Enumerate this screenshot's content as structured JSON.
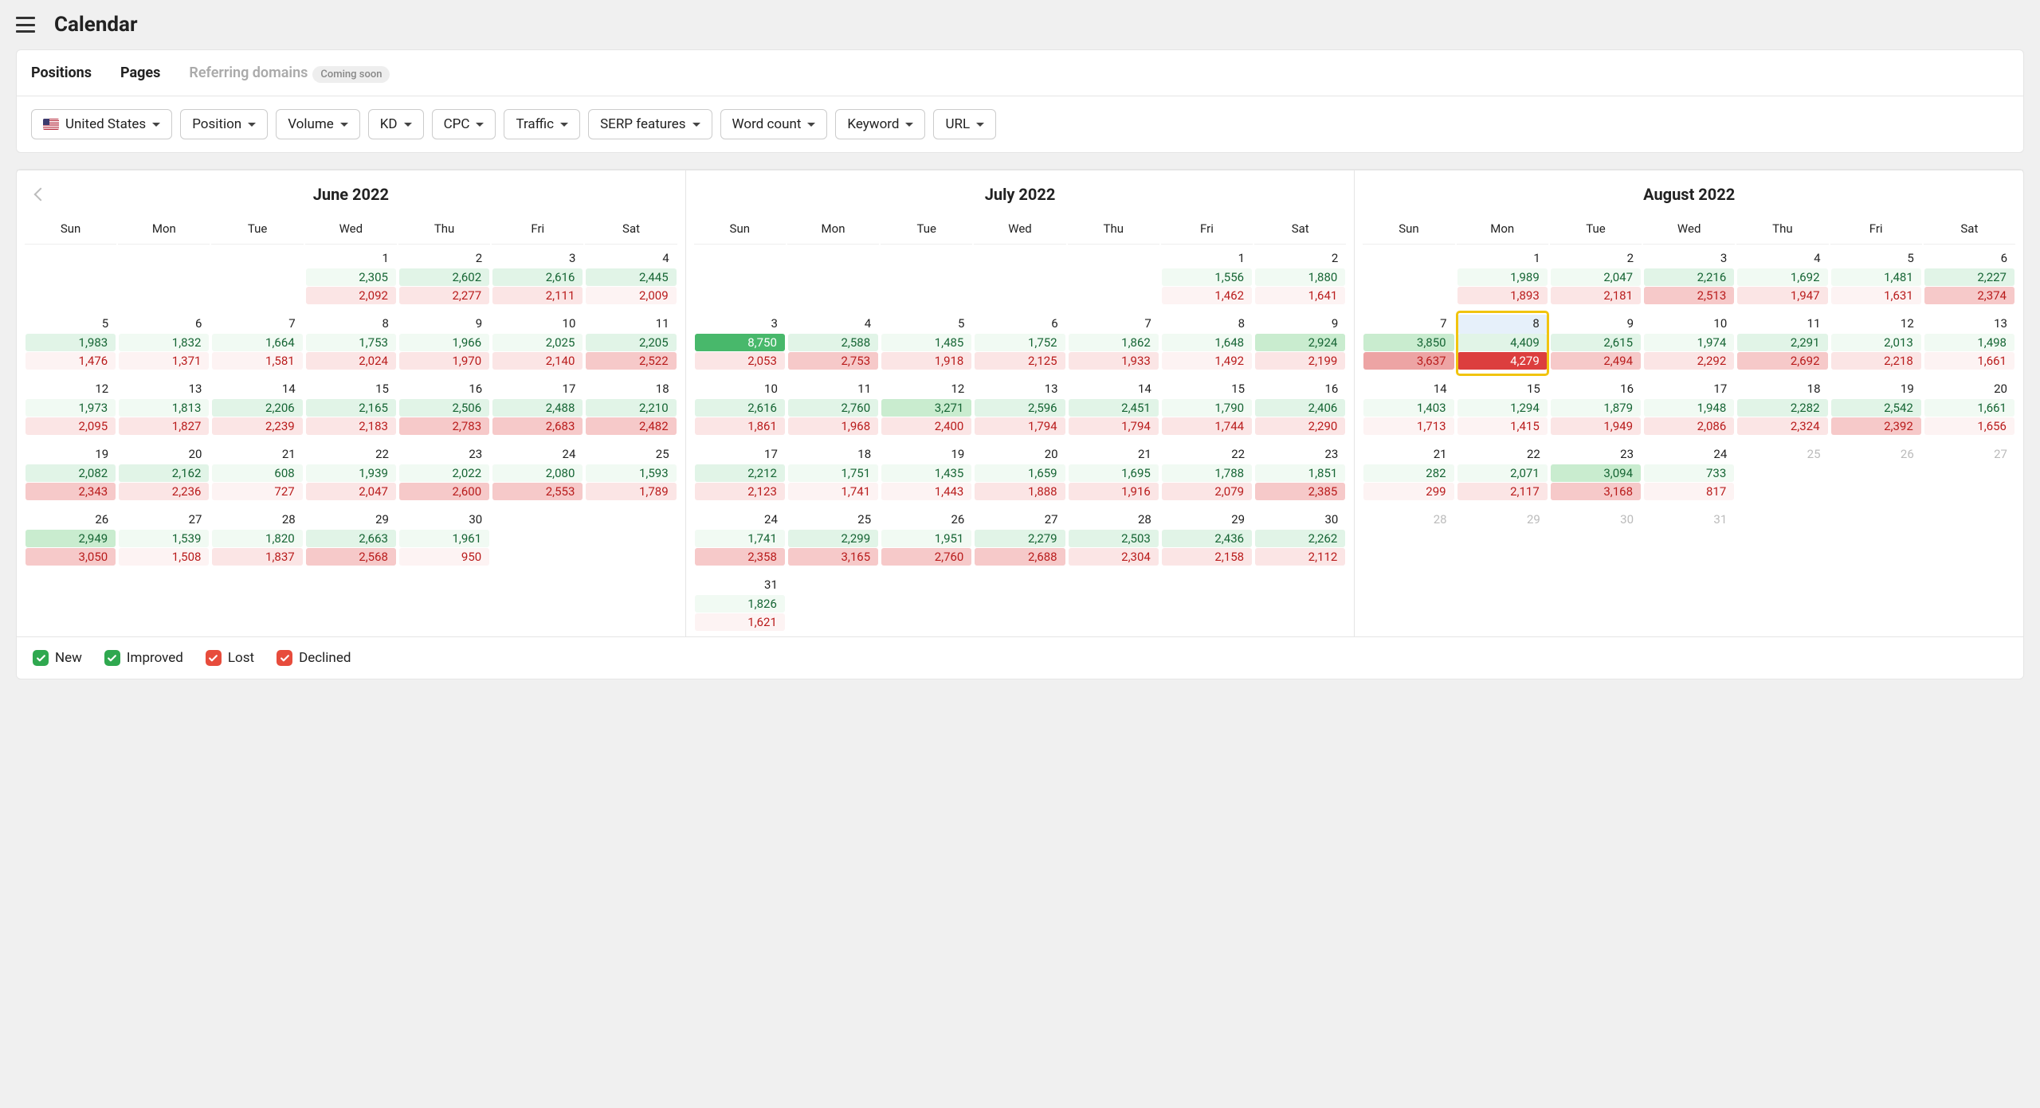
{
  "page_title": "Calendar",
  "tabs": [
    {
      "label": "Positions",
      "active": true
    },
    {
      "label": "Pages",
      "active": false
    },
    {
      "label": "Referring domains",
      "active": false,
      "badge": "Coming soon"
    }
  ],
  "filters": [
    {
      "label": "United States",
      "flag": "us"
    },
    {
      "label": "Position"
    },
    {
      "label": "Volume"
    },
    {
      "label": "KD"
    },
    {
      "label": "CPC"
    },
    {
      "label": "Traffic"
    },
    {
      "label": "SERP features"
    },
    {
      "label": "Word count"
    },
    {
      "label": "Keyword"
    },
    {
      "label": "URL"
    }
  ],
  "legend": [
    "New",
    "Improved",
    "Lost",
    "Declined"
  ],
  "dow": [
    "Sun",
    "Mon",
    "Tue",
    "Wed",
    "Thu",
    "Fri",
    "Sat"
  ],
  "months": [
    {
      "title": "June 2022",
      "prev": true,
      "lead": 3,
      "days": [
        {
          "d": 1,
          "g": "2,305",
          "gs": 0,
          "r": "2,092",
          "rs": 1
        },
        {
          "d": 2,
          "g": "2,602",
          "gs": 1,
          "r": "2,277",
          "rs": 1
        },
        {
          "d": 3,
          "g": "2,616",
          "gs": 1,
          "r": "2,111",
          "rs": 1
        },
        {
          "d": 4,
          "g": "2,445",
          "gs": 1,
          "r": "2,009",
          "rs": 0
        },
        {
          "d": 5,
          "g": "1,983",
          "gs": 1,
          "r": "1,476",
          "rs": 0
        },
        {
          "d": 6,
          "g": "1,832",
          "gs": 0,
          "r": "1,371",
          "rs": 0
        },
        {
          "d": 7,
          "g": "1,664",
          "gs": 0,
          "r": "1,581",
          "rs": 0
        },
        {
          "d": 8,
          "g": "1,753",
          "gs": 0,
          "r": "2,024",
          "rs": 1
        },
        {
          "d": 9,
          "g": "1,966",
          "gs": 0,
          "r": "1,970",
          "rs": 1
        },
        {
          "d": 10,
          "g": "2,025",
          "gs": 0,
          "r": "2,140",
          "rs": 1
        },
        {
          "d": 11,
          "g": "2,205",
          "gs": 1,
          "r": "2,522",
          "rs": 2
        },
        {
          "d": 12,
          "g": "1,973",
          "gs": 0,
          "r": "2,095",
          "rs": 1
        },
        {
          "d": 13,
          "g": "1,813",
          "gs": 0,
          "r": "1,827",
          "rs": 1
        },
        {
          "d": 14,
          "g": "2,206",
          "gs": 1,
          "r": "2,239",
          "rs": 1
        },
        {
          "d": 15,
          "g": "2,165",
          "gs": 1,
          "r": "2,183",
          "rs": 1
        },
        {
          "d": 16,
          "g": "2,506",
          "gs": 1,
          "r": "2,783",
          "rs": 2
        },
        {
          "d": 17,
          "g": "2,488",
          "gs": 1,
          "r": "2,683",
          "rs": 2
        },
        {
          "d": 18,
          "g": "2,210",
          "gs": 1,
          "r": "2,482",
          "rs": 2
        },
        {
          "d": 19,
          "g": "2,082",
          "gs": 1,
          "r": "2,343",
          "rs": 2
        },
        {
          "d": 20,
          "g": "2,162",
          "gs": 1,
          "r": "2,236",
          "rs": 1
        },
        {
          "d": 21,
          "g": "608",
          "gs": 0,
          "r": "727",
          "rs": 0
        },
        {
          "d": 22,
          "g": "1,939",
          "gs": 0,
          "r": "2,047",
          "rs": 1
        },
        {
          "d": 23,
          "g": "2,022",
          "gs": 0,
          "r": "2,600",
          "rs": 2
        },
        {
          "d": 24,
          "g": "2,080",
          "gs": 0,
          "r": "2,553",
          "rs": 2
        },
        {
          "d": 25,
          "g": "1,593",
          "gs": 0,
          "r": "1,789",
          "rs": 1
        },
        {
          "d": 26,
          "g": "2,949",
          "gs": 2,
          "r": "3,050",
          "rs": 2
        },
        {
          "d": 27,
          "g": "1,539",
          "gs": 0,
          "r": "1,508",
          "rs": 0
        },
        {
          "d": 28,
          "g": "1,820",
          "gs": 0,
          "r": "1,837",
          "rs": 1
        },
        {
          "d": 29,
          "g": "2,663",
          "gs": 1,
          "r": "2,568",
          "rs": 2
        },
        {
          "d": 30,
          "g": "1,961",
          "gs": 0,
          "r": "950",
          "rs": 0
        }
      ]
    },
    {
      "title": "July 2022",
      "lead": 5,
      "days": [
        {
          "d": 1,
          "g": "1,556",
          "gs": 0,
          "r": "1,462",
          "rs": 0
        },
        {
          "d": 2,
          "g": "1,880",
          "gs": 0,
          "r": "1,641",
          "rs": 0
        },
        {
          "d": 3,
          "g": "8,750",
          "gs": 4,
          "r": "2,053",
          "rs": 1
        },
        {
          "d": 4,
          "g": "2,588",
          "gs": 1,
          "r": "2,753",
          "rs": 2
        },
        {
          "d": 5,
          "g": "1,485",
          "gs": 0,
          "r": "1,918",
          "rs": 1
        },
        {
          "d": 6,
          "g": "1,752",
          "gs": 0,
          "r": "2,125",
          "rs": 1
        },
        {
          "d": 7,
          "g": "1,862",
          "gs": 0,
          "r": "1,933",
          "rs": 1
        },
        {
          "d": 8,
          "g": "1,648",
          "gs": 0,
          "r": "1,492",
          "rs": 0
        },
        {
          "d": 9,
          "g": "2,924",
          "gs": 2,
          "r": "2,199",
          "rs": 1
        },
        {
          "d": 10,
          "g": "2,616",
          "gs": 1,
          "r": "1,861",
          "rs": 1
        },
        {
          "d": 11,
          "g": "2,760",
          "gs": 1,
          "r": "1,968",
          "rs": 1
        },
        {
          "d": 12,
          "g": "3,271",
          "gs": 2,
          "r": "2,400",
          "rs": 1
        },
        {
          "d": 13,
          "g": "2,596",
          "gs": 1,
          "r": "1,794",
          "rs": 1
        },
        {
          "d": 14,
          "g": "2,451",
          "gs": 1,
          "r": "1,794",
          "rs": 1
        },
        {
          "d": 15,
          "g": "1,790",
          "gs": 0,
          "r": "1,744",
          "rs": 1
        },
        {
          "d": 16,
          "g": "2,406",
          "gs": 1,
          "r": "2,290",
          "rs": 1
        },
        {
          "d": 17,
          "g": "2,212",
          "gs": 1,
          "r": "2,123",
          "rs": 1
        },
        {
          "d": 18,
          "g": "1,751",
          "gs": 0,
          "r": "1,741",
          "rs": 0
        },
        {
          "d": 19,
          "g": "1,435",
          "gs": 0,
          "r": "1,443",
          "rs": 0
        },
        {
          "d": 20,
          "g": "1,659",
          "gs": 0,
          "r": "1,888",
          "rs": 1
        },
        {
          "d": 21,
          "g": "1,695",
          "gs": 0,
          "r": "1,916",
          "rs": 1
        },
        {
          "d": 22,
          "g": "1,788",
          "gs": 0,
          "r": "2,079",
          "rs": 1
        },
        {
          "d": 23,
          "g": "1,851",
          "gs": 0,
          "r": "2,385",
          "rs": 2
        },
        {
          "d": 24,
          "g": "1,741",
          "gs": 0,
          "r": "2,358",
          "rs": 2
        },
        {
          "d": 25,
          "g": "2,299",
          "gs": 1,
          "r": "3,165",
          "rs": 2
        },
        {
          "d": 26,
          "g": "1,951",
          "gs": 0,
          "r": "2,760",
          "rs": 2
        },
        {
          "d": 27,
          "g": "2,279",
          "gs": 1,
          "r": "2,688",
          "rs": 2
        },
        {
          "d": 28,
          "g": "2,503",
          "gs": 1,
          "r": "2,304",
          "rs": 1
        },
        {
          "d": 29,
          "g": "2,436",
          "gs": 1,
          "r": "2,158",
          "rs": 1
        },
        {
          "d": 30,
          "g": "2,262",
          "gs": 1,
          "r": "2,112",
          "rs": 1
        },
        {
          "d": 31,
          "g": "1,826",
          "gs": 0,
          "r": "1,621",
          "rs": 0
        }
      ]
    },
    {
      "title": "August 2022",
      "lead": 1,
      "days": [
        {
          "d": 1,
          "g": "1,989",
          "gs": 0,
          "r": "1,893",
          "rs": 1
        },
        {
          "d": 2,
          "g": "2,047",
          "gs": 0,
          "r": "2,181",
          "rs": 1
        },
        {
          "d": 3,
          "g": "2,216",
          "gs": 1,
          "r": "2,513",
          "rs": 2
        },
        {
          "d": 4,
          "g": "1,692",
          "gs": 0,
          "r": "1,947",
          "rs": 1
        },
        {
          "d": 5,
          "g": "1,481",
          "gs": 0,
          "r": "1,631",
          "rs": 0
        },
        {
          "d": 6,
          "g": "2,227",
          "gs": 1,
          "r": "2,374",
          "rs": 2
        },
        {
          "d": 7,
          "g": "3,850",
          "gs": 2,
          "r": "3,637",
          "rs": 3
        },
        {
          "d": 8,
          "g": "4,409",
          "gs": 1,
          "r": "4,279",
          "rs": 4,
          "highlight": true
        },
        {
          "d": 9,
          "g": "2,615",
          "gs": 1,
          "r": "2,494",
          "rs": 2
        },
        {
          "d": 10,
          "g": "1,974",
          "gs": 0,
          "r": "2,292",
          "rs": 1
        },
        {
          "d": 11,
          "g": "2,291",
          "gs": 1,
          "r": "2,692",
          "rs": 2
        },
        {
          "d": 12,
          "g": "2,013",
          "gs": 0,
          "r": "2,218",
          "rs": 1
        },
        {
          "d": 13,
          "g": "1,498",
          "gs": 0,
          "r": "1,661",
          "rs": 0
        },
        {
          "d": 14,
          "g": "1,403",
          "gs": 0,
          "r": "1,713",
          "rs": 0
        },
        {
          "d": 15,
          "g": "1,294",
          "gs": 0,
          "r": "1,415",
          "rs": 0
        },
        {
          "d": 16,
          "g": "1,879",
          "gs": 0,
          "r": "1,949",
          "rs": 1
        },
        {
          "d": 17,
          "g": "1,948",
          "gs": 0,
          "r": "2,086",
          "rs": 1
        },
        {
          "d": 18,
          "g": "2,282",
          "gs": 1,
          "r": "2,324",
          "rs": 1
        },
        {
          "d": 19,
          "g": "2,542",
          "gs": 1,
          "r": "2,392",
          "rs": 2
        },
        {
          "d": 20,
          "g": "1,661",
          "gs": 0,
          "r": "1,656",
          "rs": 0
        },
        {
          "d": 21,
          "g": "282",
          "gs": 0,
          "r": "299",
          "rs": 0
        },
        {
          "d": 22,
          "g": "2,071",
          "gs": 0,
          "r": "2,117",
          "rs": 1
        },
        {
          "d": 23,
          "g": "3,094",
          "gs": 2,
          "r": "3,168",
          "rs": 2
        },
        {
          "d": 24,
          "g": "733",
          "gs": 0,
          "r": "817",
          "rs": 0
        },
        {
          "d": 25,
          "dim": true
        },
        {
          "d": 26,
          "dim": true
        },
        {
          "d": 27,
          "dim": true
        },
        {
          "d": 28,
          "dim": true
        },
        {
          "d": 29,
          "dim": true
        },
        {
          "d": 30,
          "dim": true
        },
        {
          "d": 31,
          "dim": true
        }
      ]
    }
  ]
}
